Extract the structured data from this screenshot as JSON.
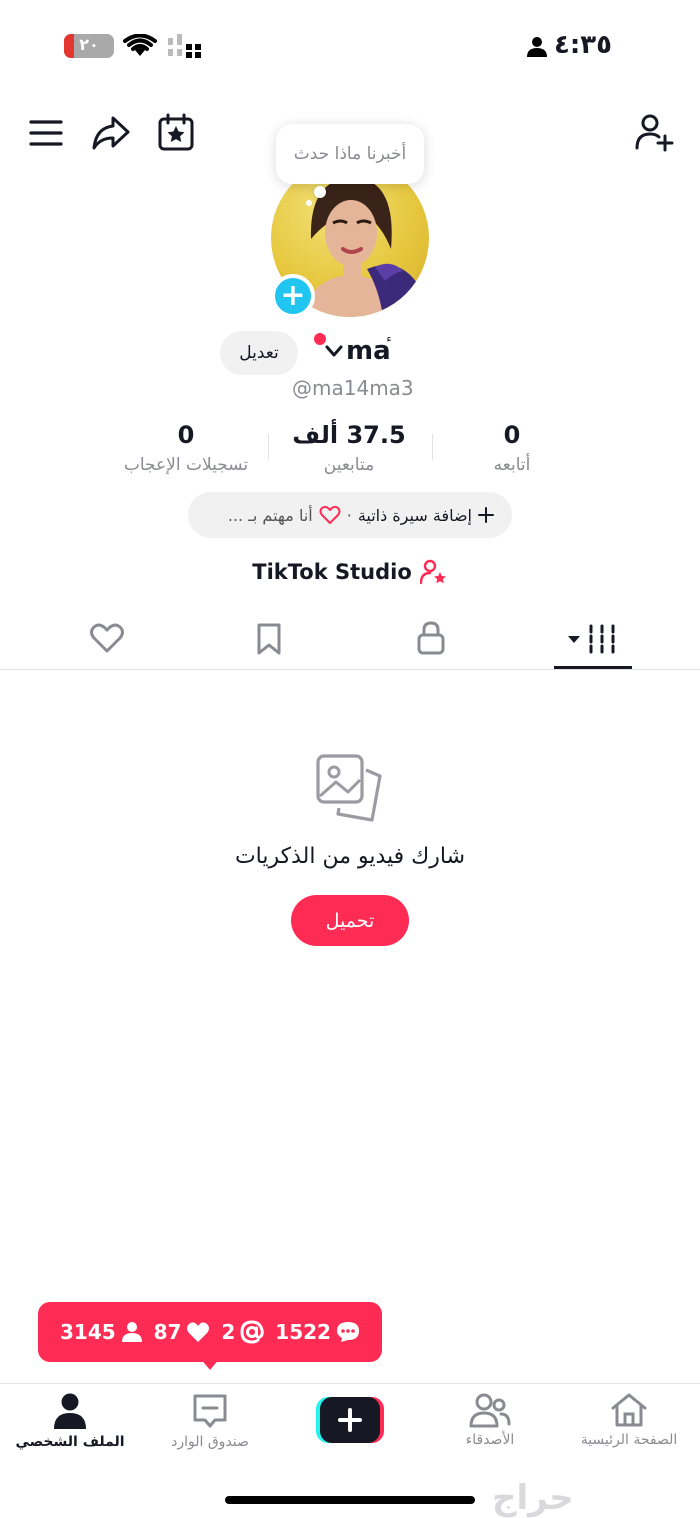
{
  "status_bar": {
    "time": "٤:٣٥",
    "battery_level": "٢٠",
    "battery_fraction": 0.2
  },
  "profile": {
    "tooltip": "أخبرنا ماذا حدث",
    "display_name": "ma",
    "name_mark": "ٔ",
    "handle": "@ma14ma3",
    "edit_label": "تعديل",
    "avatar_plus": "+"
  },
  "stats": [
    {
      "value": "0",
      "label": "أتابعه"
    },
    {
      "value": "37.5 ألف",
      "label": "متابعين"
    },
    {
      "value": "0",
      "label": "تسجيلات الإعجاب"
    }
  ],
  "bio": {
    "add_bio": "إضافة سيرة ذاتية",
    "separator": "·",
    "interested": "أنا مهتم بـ ..."
  },
  "studio": {
    "label": "TikTok Studio"
  },
  "tabs": [
    "videos",
    "private",
    "saved",
    "liked"
  ],
  "empty_state": {
    "message": "شارك فيديو من الذكريات",
    "upload_label": "تحميل"
  },
  "notification": {
    "comments": "1522",
    "mentions": "2",
    "likes": "87",
    "followers": "3145"
  },
  "bottom_nav": {
    "home": "الصفحة الرئيسية",
    "friends": "الأصدقاء",
    "inbox": "صندوق الوارد",
    "profile": "الملف الشخصي"
  },
  "watermark": "حراج",
  "colors": {
    "accent": "#fe2c55",
    "plus_blue": "#20c5f0",
    "text": "#161823",
    "muted": "#8a8b91"
  }
}
